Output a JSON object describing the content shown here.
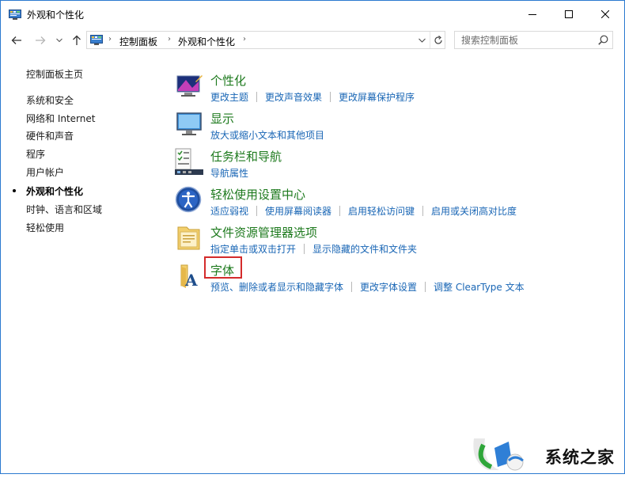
{
  "window": {
    "title": "外观和个性化"
  },
  "address": {
    "crumbs": [
      "控制面板",
      "外观和个性化"
    ]
  },
  "search": {
    "placeholder": "搜索控制面板"
  },
  "sidebar": {
    "items": [
      {
        "label": "控制面板主页",
        "active": false
      },
      {
        "label": "系统和安全",
        "active": false
      },
      {
        "label": "网络和 Internet",
        "active": false
      },
      {
        "label": "硬件和声音",
        "active": false
      },
      {
        "label": "程序",
        "active": false
      },
      {
        "label": "用户帐户",
        "active": false
      },
      {
        "label": "外观和个性化",
        "active": true
      },
      {
        "label": "时钟、语言和区域",
        "active": false
      },
      {
        "label": "轻松使用",
        "active": false
      }
    ]
  },
  "categories": [
    {
      "title": "个性化",
      "icon": "personalization-icon",
      "links": [
        "更改主题",
        "更改声音效果",
        "更改屏幕保护程序"
      ]
    },
    {
      "title": "显示",
      "icon": "display-icon",
      "links": [
        "放大或缩小文本和其他项目"
      ]
    },
    {
      "title": "任务栏和导航",
      "icon": "taskbar-icon",
      "links": [
        "导航属性"
      ]
    },
    {
      "title": "轻松使用设置中心",
      "icon": "ease-of-access-icon",
      "links": [
        "适应弱视",
        "使用屏幕阅读器",
        "启用轻松访问键",
        "启用或关闭高对比度"
      ]
    },
    {
      "title": "文件资源管理器选项",
      "icon": "folder-options-icon",
      "links": [
        "指定单击或双击打开",
        "显示隐藏的文件和文件夹"
      ]
    },
    {
      "title": "字体",
      "icon": "fonts-icon",
      "links": [
        "预览、删除或者显示和隐藏字体",
        "更改字体设置",
        "调整 ClearType 文本"
      ]
    }
  ],
  "watermark": {
    "text": "系统之家"
  },
  "colors": {
    "category_title": "#1e7a1e",
    "link": "#1966b5",
    "highlight": "#d42b2b",
    "window_border": "#2b79d0"
  }
}
